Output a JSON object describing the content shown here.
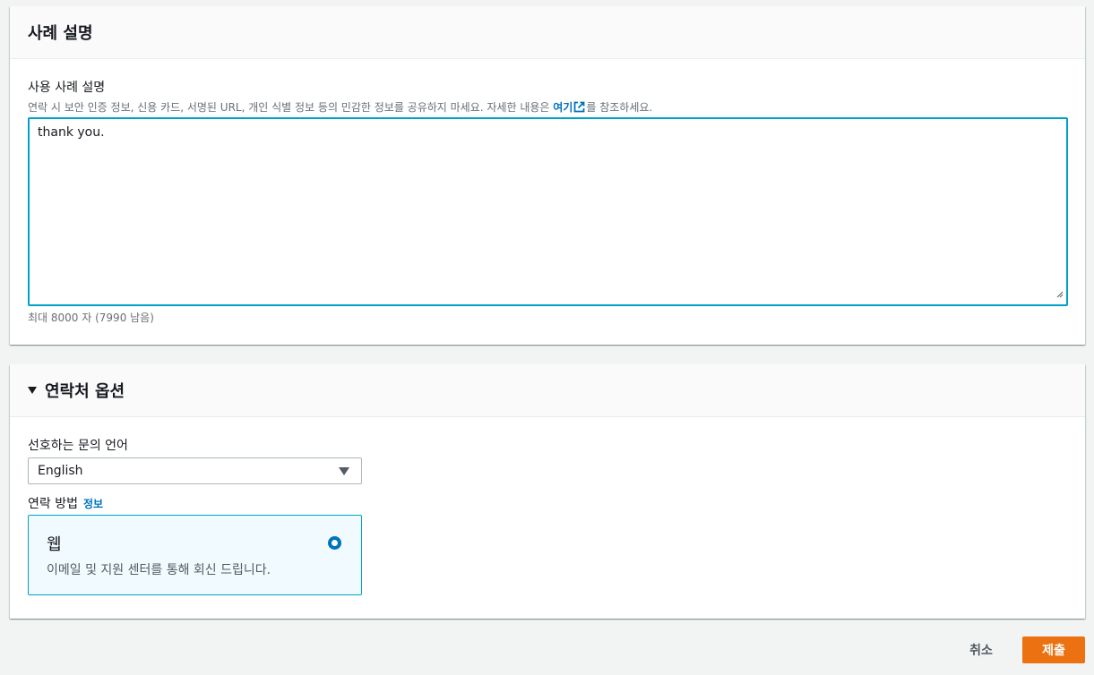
{
  "case_panel": {
    "title": "사례 설명",
    "field_label": "사용 사례 설명",
    "description_prefix": "연락 시 보안 인증 정보, 신용 카드, 서명된 URL, 개인 식별 정보 등의 민감한 정보를 공유하지 마세요. 자세한 내용은 ",
    "description_link": "여기",
    "description_suffix": "를 참조하세요.",
    "textarea_value": "thank you.",
    "char_constraint": "최대 8000 자 (7990 남음)"
  },
  "contact_panel": {
    "title": "연락처 옵션",
    "language_label": "선호하는 문의 언어",
    "language_selected": "English",
    "method_label": "연락 방법",
    "method_info": "정보",
    "tile": {
      "title": "웹",
      "description": "이메일 및 지원 센터를 통해 회신 드립니다.",
      "selected": true
    }
  },
  "actions": {
    "cancel_label": "취소",
    "submit_label": "제출"
  },
  "colors": {
    "accent": "#0073bb",
    "focus_border": "#00a1c9",
    "primary_button": "#ec7211",
    "tile_background": "#f1faff"
  },
  "icons": {
    "external_link": "external-link-icon",
    "collapse_caret": "caret-down-icon",
    "select_arrow": "dropdown-arrow-icon",
    "resize_grip": "resize-grip-icon"
  }
}
